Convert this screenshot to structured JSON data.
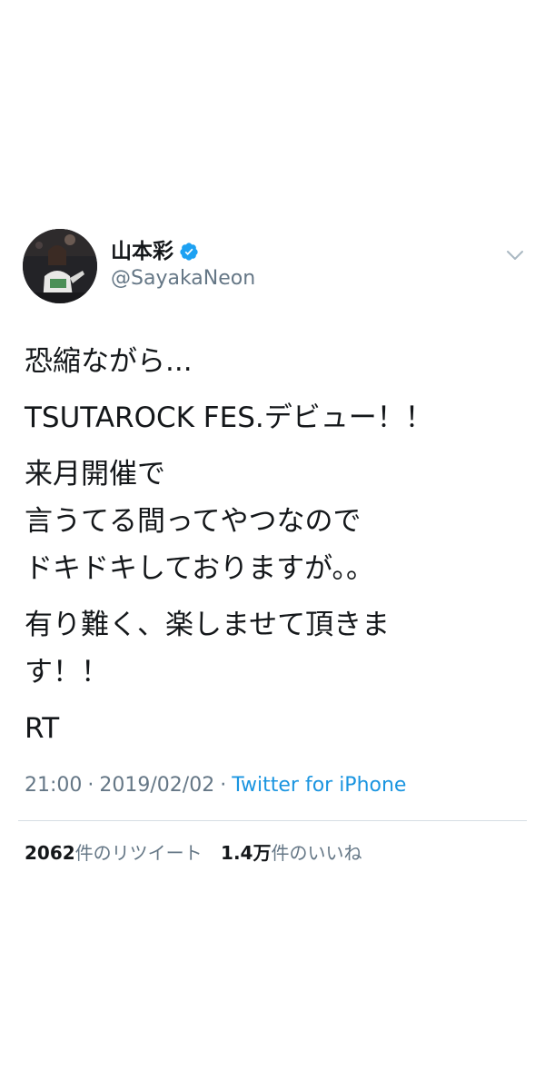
{
  "user": {
    "display_name": "山本彩",
    "handle": "@SayakaNeon",
    "verified": true
  },
  "tweet": {
    "paragraphs": [
      "恐縮ながら...",
      "TSUTAROCK FES.デビュー！！",
      "来月開催で\n言うてる間ってやつなので\nドキドキしておりますが。。",
      "有り難く、楽しませて頂きま\nす！！",
      "RT"
    ]
  },
  "meta": {
    "time": "21:00",
    "separator": "·",
    "date": "2019/02/02",
    "source": "Twitter for iPhone"
  },
  "stats": {
    "retweets_count": "2062",
    "retweets_label": "件のリツイート",
    "likes_count": "1.4万",
    "likes_label": "件のいいね"
  },
  "colors": {
    "verified": "#1da1f2",
    "link": "#1b95e0",
    "secondary_text": "#657786",
    "primary_text": "#14171a",
    "divider": "#d6dde3"
  },
  "icons": {
    "verified": "verified-badge-icon",
    "caret": "chevron-down-icon"
  }
}
